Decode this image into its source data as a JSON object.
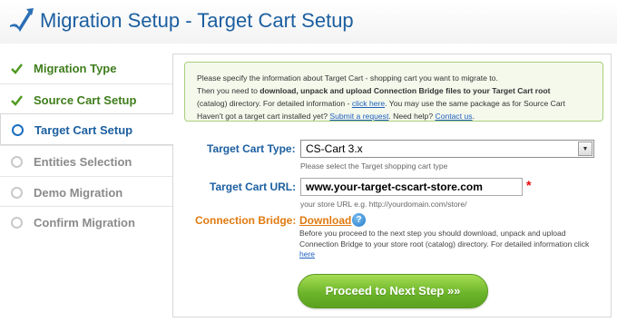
{
  "header": {
    "title": "Migration Setup - Target Cart Setup",
    "logo_icon": "arrow-logo-icon"
  },
  "sidebar": {
    "items": [
      {
        "label": "Migration Type",
        "state": "done",
        "icon": "check-icon"
      },
      {
        "label": "Source Cart Setup",
        "state": "done",
        "icon": "check-icon"
      },
      {
        "label": "Target Cart Setup",
        "state": "active",
        "icon": "circle-icon"
      },
      {
        "label": "Entities Selection",
        "state": "pending",
        "icon": "circle-icon"
      },
      {
        "label": "Demo Migration",
        "state": "pending",
        "icon": "circle-icon"
      },
      {
        "label": "Confirm Migration",
        "state": "pending",
        "icon": "circle-icon"
      }
    ]
  },
  "info": {
    "line1": "Please specify the information about Target Cart - shopping cart you want to migrate to.",
    "line2_a": "Then you need to ",
    "line2_b": "download, unpack and upload Connection Bridge files to your Target Cart root",
    "line3_a": "(catalog) directory. For detailed information - ",
    "line3_link": "click here",
    "line3_b": ". You may use the same package as for Source Cart",
    "line4_a": "Haven't got a target cart installed yet? ",
    "line4_link1": "Submit a request",
    "line4_b": ". Need help? ",
    "line4_link2": "Contact us",
    "line4_c": "."
  },
  "form": {
    "cart_type_label": "Target Cart Type:",
    "cart_type_value": "CS-Cart 3.x",
    "cart_type_hint": "Please select the Target shopping cart type",
    "cart_url_label": "Target Cart URL:",
    "cart_url_value": "www.your-target-cscart-store.com",
    "cart_url_hint": "your store URL e.g. http://yourdomain.com/store/",
    "required_mark": "*",
    "bridge_label": "Connection Bridge:",
    "bridge_link": "Download",
    "help_mark": "?",
    "bridge_desc": "Before you proceed to the next step you should download, unpack and upload Connection Bridge to your store root (catalog) directory. For detailed information click",
    "bridge_desc_link": "here"
  },
  "actions": {
    "next_label": "Proceed to Next Step »»"
  },
  "colors": {
    "title_blue": "#1c5fa0",
    "done_green": "#3f7d1c",
    "bridge_orange": "#e07a10",
    "button_green": "#6db52b"
  }
}
